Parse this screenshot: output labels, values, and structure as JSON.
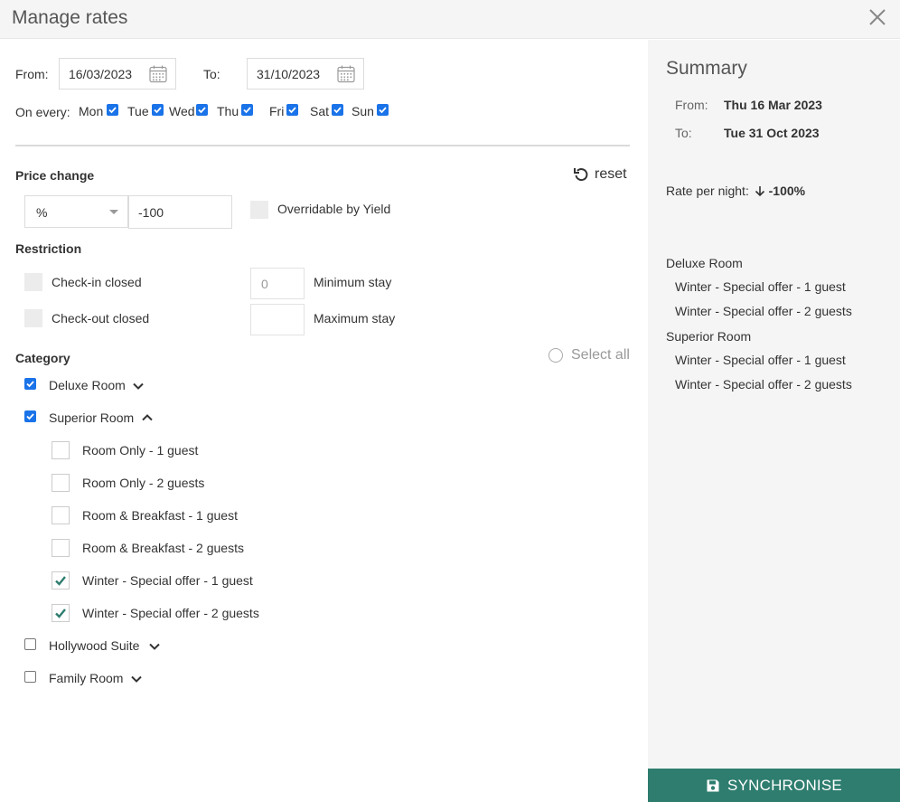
{
  "dialog": {
    "title": "Manage rates"
  },
  "dates": {
    "from_label": "From:",
    "from_value": "16/03/2023",
    "to_label": "To:",
    "to_value": "31/10/2023"
  },
  "days": {
    "label": "On every:",
    "items": [
      {
        "label": "Mon",
        "checked": true
      },
      {
        "label": "Tue",
        "checked": true
      },
      {
        "label": "Wed",
        "checked": true
      },
      {
        "label": "Thu",
        "checked": true
      },
      {
        "label": "Fri",
        "checked": true
      },
      {
        "label": "Sat",
        "checked": true
      },
      {
        "label": "Sun",
        "checked": true
      }
    ]
  },
  "price_change": {
    "heading": "Price change",
    "reset_label": "reset",
    "unit": "%",
    "value": "-100",
    "overridable_label": "Overridable by Yield"
  },
  "restriction": {
    "heading": "Restriction",
    "checkin_label": "Check-in closed",
    "checkout_label": "Check-out closed",
    "min_stay_value": "0",
    "min_stay_label": "Minimum stay",
    "max_stay_value": "",
    "max_stay_label": "Maximum stay"
  },
  "category": {
    "heading": "Category",
    "select_all_label": "Select all",
    "items": [
      {
        "label": "Deluxe Room",
        "checked": true,
        "expanded": false
      },
      {
        "label": "Superior Room",
        "checked": true,
        "expanded": true,
        "rates": [
          {
            "label": "Room Only - 1 guest",
            "checked": false
          },
          {
            "label": "Room Only - 2 guests",
            "checked": false
          },
          {
            "label": "Room & Breakfast - 1 guest",
            "checked": false
          },
          {
            "label": "Room & Breakfast - 2 guests",
            "checked": false
          },
          {
            "label": "Winter - Special offer - 1 guest",
            "checked": true
          },
          {
            "label": "Winter - Special offer - 2 guests",
            "checked": true
          }
        ]
      },
      {
        "label": "Hollywood Suite",
        "checked": false,
        "expanded": false
      },
      {
        "label": "Family Room",
        "checked": false,
        "expanded": false
      }
    ]
  },
  "summary": {
    "title": "Summary",
    "from_label": "From:",
    "from_value": "Thu 16 Mar 2023",
    "to_label": "To:",
    "to_value": "Tue 31 Oct 2023",
    "rate_label": "Rate per night:",
    "rate_value": "-100%",
    "groups": [
      {
        "name": "Deluxe Room",
        "items": [
          "Winter - Special offer - 1 guest",
          "Winter - Special offer - 2 guests"
        ]
      },
      {
        "name": "Superior Room",
        "items": [
          "Winter - Special offer - 1 guest",
          "Winter - Special offer - 2 guests"
        ]
      }
    ],
    "sync_label": "SYNCHRONISE"
  },
  "colors": {
    "accent_blue": "#1a73e8",
    "sync_green": "#2e7d6f",
    "check_green": "#2e7d6f"
  }
}
